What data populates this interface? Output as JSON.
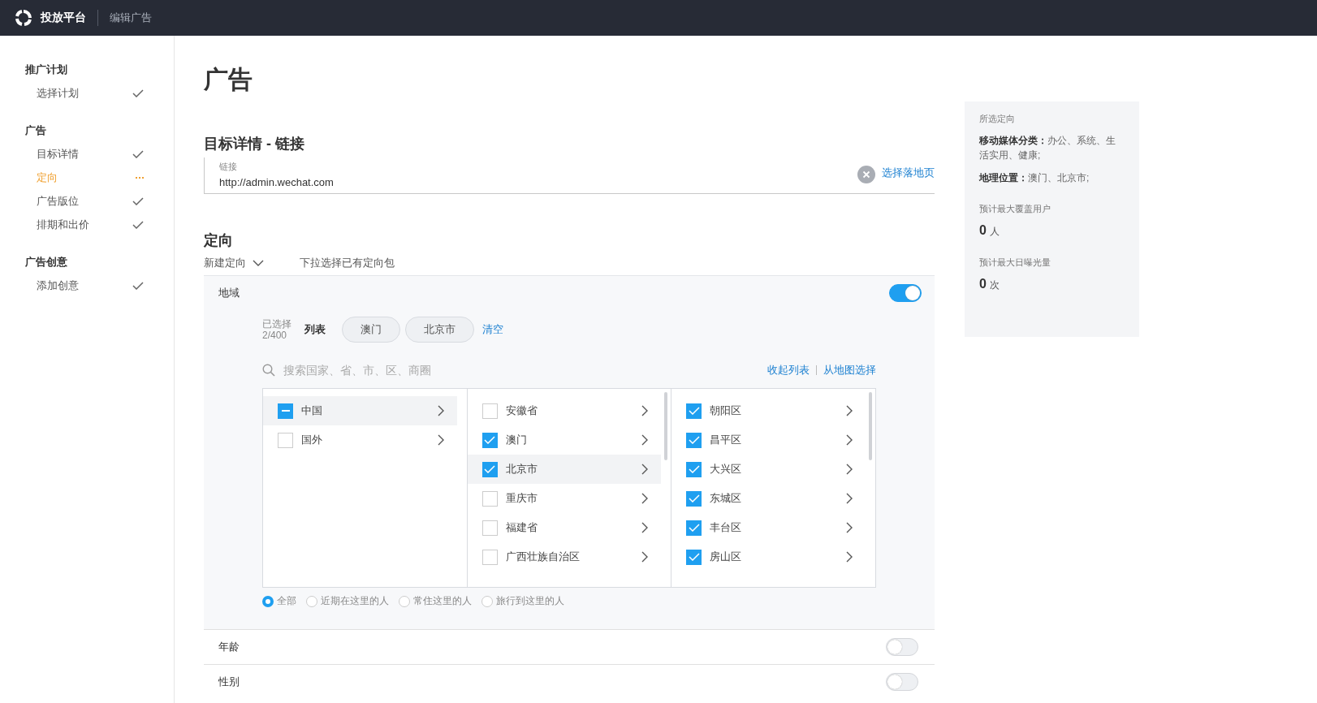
{
  "topbar": {
    "brand": "投放平台",
    "page": "编辑广告"
  },
  "sidebar": [
    {
      "title": "推广计划",
      "items": [
        {
          "label": "选择计划",
          "current": false
        }
      ]
    },
    {
      "title": "广告",
      "items": [
        {
          "label": "目标详情",
          "current": false
        },
        {
          "label": "定向",
          "current": true
        },
        {
          "label": "广告版位",
          "current": false
        },
        {
          "label": "排期和出价",
          "current": false
        }
      ]
    },
    {
      "title": "广告创意",
      "items": [
        {
          "label": "添加创意",
          "current": false
        }
      ]
    }
  ],
  "page_title": "广告",
  "target": {
    "heading": "目标详情 - 链接",
    "field_label": "链接",
    "value": "http://admin.wechat.com",
    "link": "选择落地页"
  },
  "targeting": {
    "heading": "定向",
    "new_dropdown": "新建定向",
    "package_hint": "下拉选择已有定向包"
  },
  "region": {
    "label": "地域",
    "on": true,
    "selected_label": "已选择",
    "selected_count": "2/400",
    "list_label": "列表",
    "tags": [
      "澳门",
      "北京市"
    ],
    "clear": "清空",
    "search_placeholder": "搜索国家、省、市、区、商圈",
    "collapse": "收起列表",
    "map_select": "从地图选择",
    "columns": [
      [
        {
          "label": "中国",
          "checked": false,
          "partial": true,
          "selected": true
        },
        {
          "label": "国外",
          "checked": false,
          "partial": false,
          "selected": false
        }
      ],
      [
        {
          "label": "安徽省",
          "checked": false,
          "selected": false
        },
        {
          "label": "澳门",
          "checked": true,
          "selected": false
        },
        {
          "label": "北京市",
          "checked": true,
          "selected": true
        },
        {
          "label": "重庆市",
          "checked": false,
          "selected": false
        },
        {
          "label": "福建省",
          "checked": false,
          "selected": false
        },
        {
          "label": "广西壮族自治区",
          "checked": false,
          "selected": false
        }
      ],
      [
        {
          "label": "朝阳区",
          "checked": true,
          "selected": false
        },
        {
          "label": "昌平区",
          "checked": true,
          "selected": false
        },
        {
          "label": "大兴区",
          "checked": true,
          "selected": false
        },
        {
          "label": "东城区",
          "checked": true,
          "selected": false
        },
        {
          "label": "丰台区",
          "checked": true,
          "selected": false
        },
        {
          "label": "房山区",
          "checked": true,
          "selected": false
        }
      ]
    ],
    "radios": [
      {
        "label": "全部",
        "selected": true
      },
      {
        "label": "近期在这里的人",
        "selected": false
      },
      {
        "label": "常住这里的人",
        "selected": false
      },
      {
        "label": "旅行到这里的人",
        "selected": false
      }
    ]
  },
  "other_sections": [
    {
      "label": "年龄",
      "on": false
    },
    {
      "label": "性别",
      "on": false
    }
  ],
  "summary": {
    "title": "所选定向",
    "lines": [
      "**移动媒体分类：**办公、系统、生活实用、健康;",
      "**地理位置：**澳门、北京市;"
    ],
    "stats": [
      {
        "label": "预计最大覆盖用户",
        "value": "0",
        "unit": "人"
      },
      {
        "label": "预计最大日曝光量",
        "value": "0",
        "unit": "次"
      }
    ]
  }
}
